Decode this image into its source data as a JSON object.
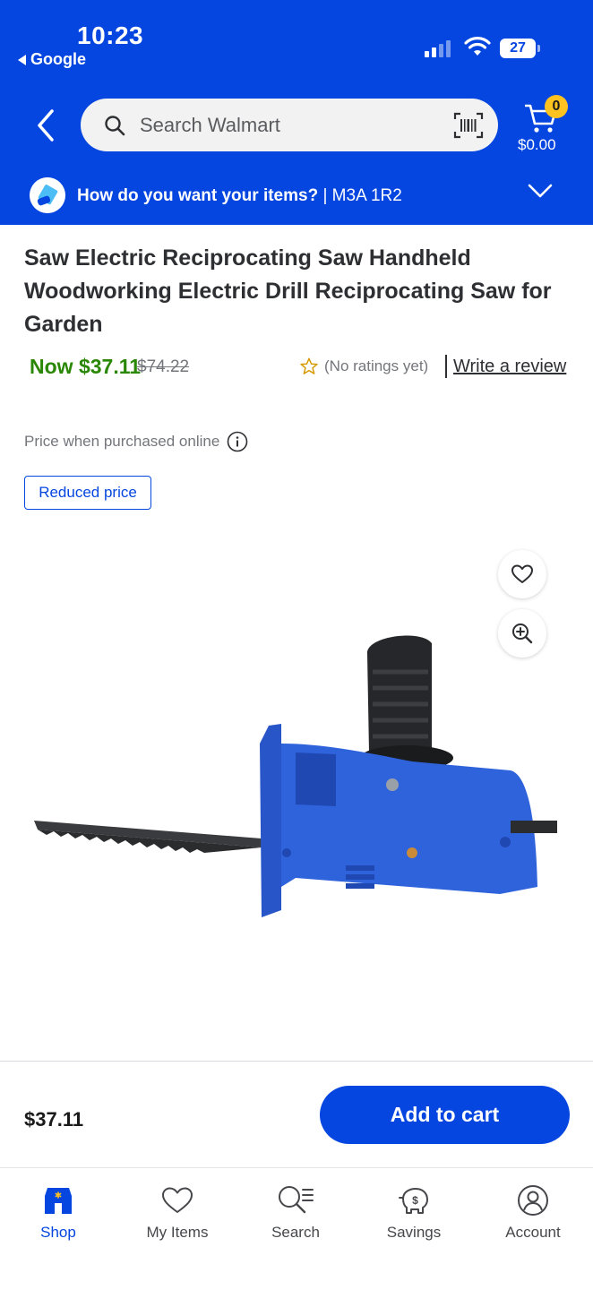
{
  "status": {
    "time": "10:23",
    "back_app": "Google",
    "battery": "27"
  },
  "header": {
    "search_placeholder": "Search Walmart",
    "cart_count": "0",
    "cart_total": "$0.00"
  },
  "fulfillment": {
    "question": "How do you want your items?",
    "postal": " | M3A 1R2"
  },
  "product": {
    "title": "Saw Electric Reciprocating Saw Handheld Woodworking Electric Drill Reciprocating Saw for Garden",
    "price_now": "Now $37.11",
    "price_was": "$74.22",
    "rating_text": "(No ratings yet)",
    "write_review": "Write a review",
    "price_note": "Price when purchased online",
    "badge": "Reduced price"
  },
  "buybar": {
    "price": "$37.11",
    "add_to_cart": "Add to cart"
  },
  "tabs": [
    {
      "label": "Shop",
      "icon": "shop-icon",
      "active": true
    },
    {
      "label": "My Items",
      "icon": "heart-icon",
      "active": false
    },
    {
      "label": "Search",
      "icon": "search-icon",
      "active": false
    },
    {
      "label": "Savings",
      "icon": "savings-icon",
      "active": false
    },
    {
      "label": "Account",
      "icon": "account-icon",
      "active": false
    }
  ],
  "colors": {
    "brand_blue": "#0546e0",
    "price_green": "#2a8703",
    "badge_yellow": "#ffc220"
  }
}
